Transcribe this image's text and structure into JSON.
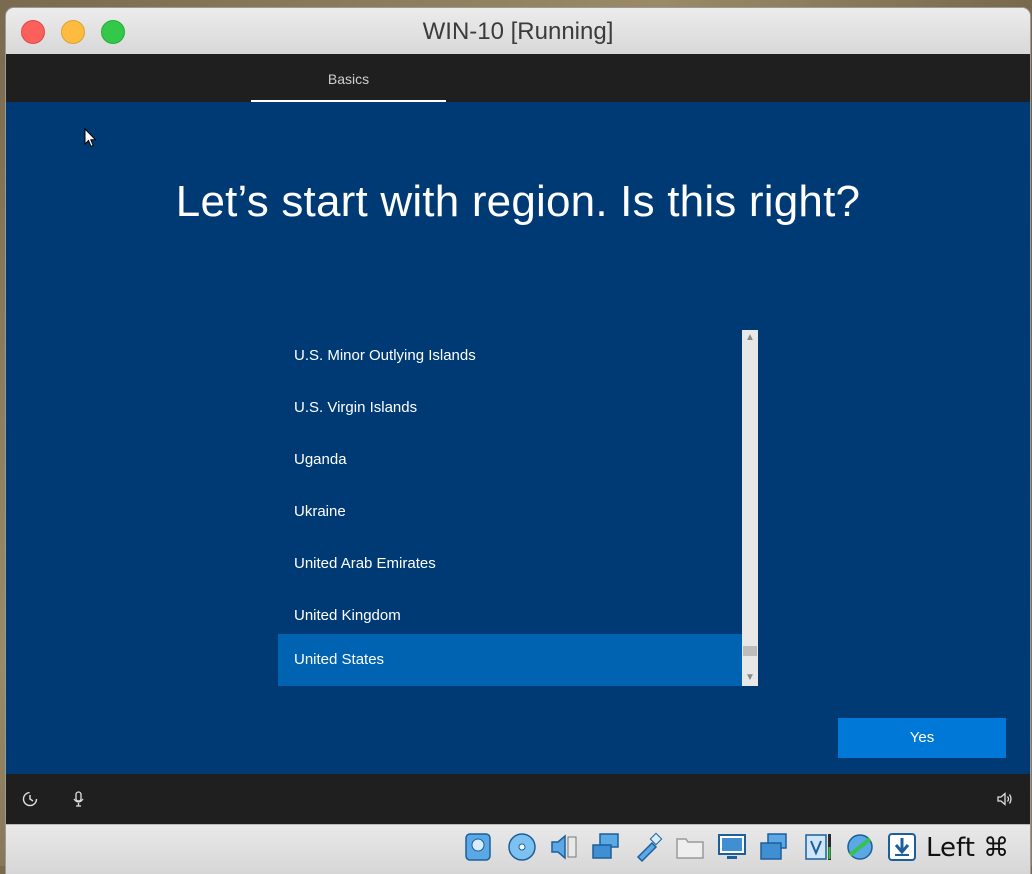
{
  "window": {
    "title": "WIN-10 [Running]"
  },
  "setup": {
    "tab_label": "Basics",
    "headline": "Let’s start with region. Is this right?",
    "regions": [
      "U.S. Minor Outlying Islands",
      "U.S. Virgin Islands",
      "Uganda",
      "Ukraine",
      "United Arab Emirates",
      "United Kingdom",
      "United States"
    ],
    "selected_region": "United States",
    "yes_label": "Yes"
  },
  "statusbar": {
    "host_key": "Left ⌘"
  },
  "colors": {
    "oobe_background": "#003a75",
    "selected_item": "#0063b1",
    "primary_button": "#0078d7",
    "header_footer": "#1f1f1f"
  },
  "icons": {
    "footer_left": [
      "ease-of-access-icon",
      "microphone-icon"
    ],
    "footer_right": "volume-icon",
    "statusbar": [
      "hard-disk-icon",
      "optical-drive-icon",
      "audio-icon",
      "network-icon",
      "usb-icon",
      "shared-folder-icon",
      "display-icon",
      "capture-icon",
      "recording-icon",
      "guest-additions-icon",
      "download-icon"
    ]
  }
}
